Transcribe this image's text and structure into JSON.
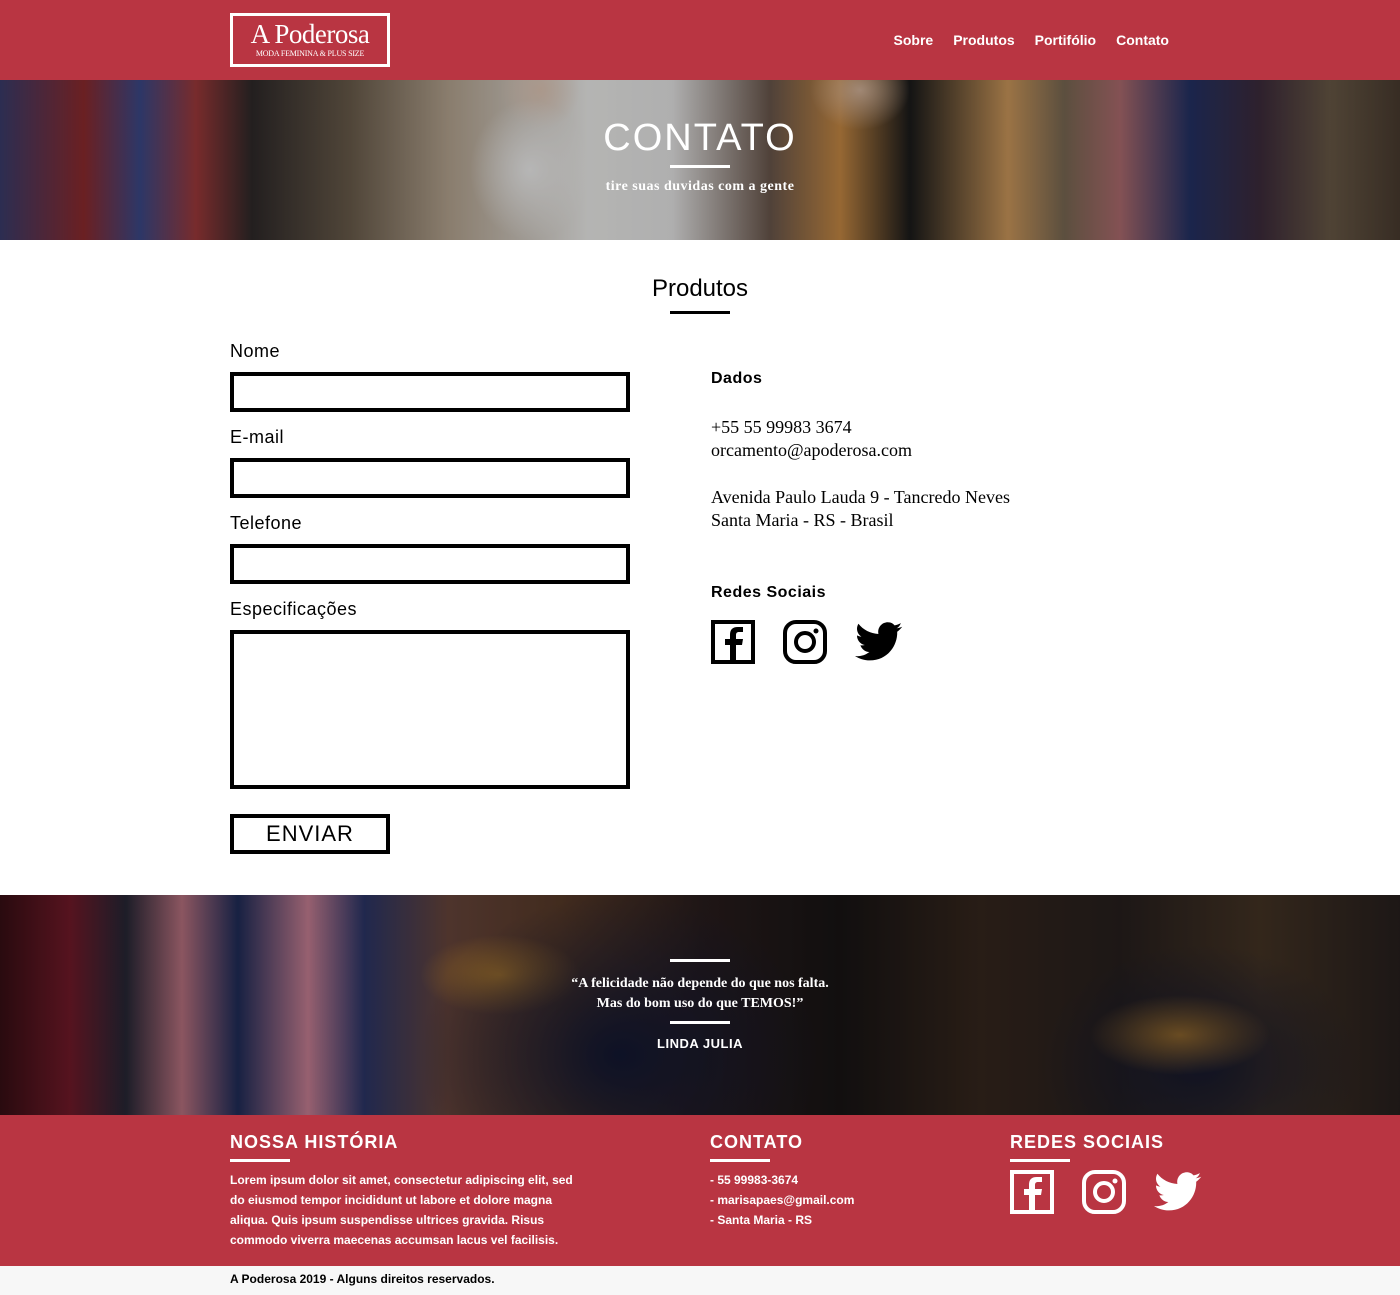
{
  "header": {
    "logo_name": "A Poderosa",
    "logo_tagline": "MODA FEMININA & PLUS SIZE",
    "nav": [
      "Sobre",
      "Produtos",
      "Portifólio",
      "Contato"
    ],
    "brand_color": "#b93542"
  },
  "hero": {
    "title": "CONTATO",
    "subtitle": "tire suas duvidas com a gente"
  },
  "section": {
    "title": "Produtos"
  },
  "form": {
    "name_label": "Nome",
    "name_value": "",
    "email_label": "E-mail",
    "email_value": "",
    "phone_label": "Telefone",
    "phone_value": "",
    "specs_label": "Especificações",
    "specs_value": "",
    "submit_label": "ENVIAR"
  },
  "info": {
    "data_heading": "Dados",
    "phone": "+55 55 99983 3674",
    "email": "orcamento@apoderosa.com",
    "address_line1": "Avenida Paulo Lauda 9 - Tancredo Neves",
    "address_line2": "Santa Maria - RS - Brasil",
    "social_heading": "Redes Sociais",
    "social_icons": [
      "facebook-icon",
      "instagram-icon",
      "twitter-icon"
    ]
  },
  "quote": {
    "line1": "“A felicidade não depende do que nos falta.",
    "line2": "Mas do bom uso do que TEMOS!”",
    "author": "LINDA JULIA"
  },
  "footer": {
    "history_heading": "NOSSA HISTÓRIA",
    "history_text": "Lorem ipsum dolor sit amet, consectetur adipiscing elit, sed do eiusmod tempor incididunt ut labore et dolore magna aliqua. Quis ipsum suspendisse ultrices gravida. Risus commodo viverra maecenas accumsan lacus vel facilisis.",
    "contact_heading": "CONTATO",
    "contact_items": [
      "- 55 99983-3674",
      "- marisapaes@gmail.com",
      "- Santa Maria - RS"
    ],
    "social_heading": "REDES SOCIAIS",
    "copyright": "A Poderosa 2019 - Alguns direitos reservados."
  }
}
